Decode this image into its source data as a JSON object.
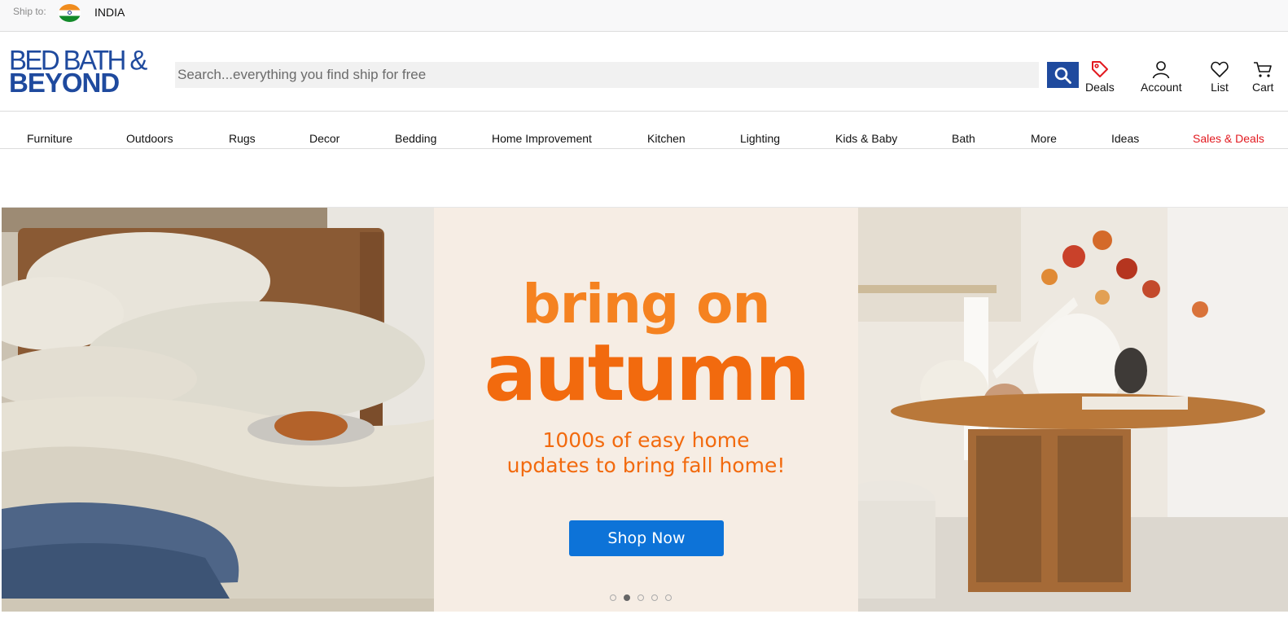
{
  "shipbar": {
    "label": "Ship to:",
    "country": "INDIA",
    "flag_icon": "india-flag-icon"
  },
  "header": {
    "logo": {
      "line1": "BED BATH &",
      "line2": "BEYOND"
    },
    "search": {
      "placeholder": "Search...everything you find ship for free",
      "value": ""
    },
    "search_icon": "search-icon",
    "items": [
      {
        "label": "Deals",
        "icon": "tag-icon"
      },
      {
        "label": "Account",
        "icon": "user-icon"
      },
      {
        "label": "List",
        "icon": "heart-icon"
      },
      {
        "label": "Cart",
        "icon": "cart-icon"
      }
    ]
  },
  "nav": {
    "items": [
      "Furniture",
      "Outdoors",
      "Rugs",
      "Decor",
      "Bedding",
      "Home Improvement",
      "Kitchen",
      "Lighting",
      "Kids & Baby",
      "Bath",
      "More",
      "Ideas",
      "Sales & Deals"
    ]
  },
  "hero": {
    "headline_line1": "bring on",
    "headline_line2": "autumn",
    "subline_line1": "1000s of easy home",
    "subline_line2": "updates to bring fall home!",
    "cta": "Shop Now",
    "carousel": {
      "slides": 5,
      "active_index": 1
    },
    "colors": {
      "orange": "#f26a0e",
      "cta_blue": "#0d73d8",
      "sale_red": "#e2191f",
      "brand_blue": "#1f4a9e"
    }
  }
}
